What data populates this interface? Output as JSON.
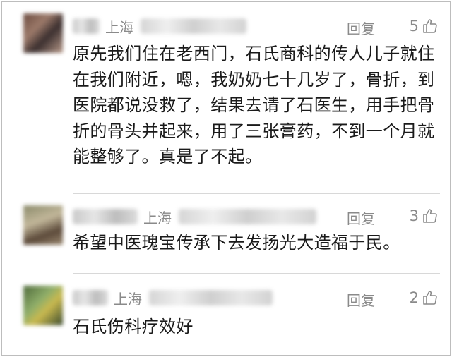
{
  "comments": [
    {
      "location": "上海",
      "reply_label": "回复",
      "likes": "5",
      "text": "原先我们住在老西门，石氏商科的传人儿子就住在我们附近，嗯，我奶奶七十几岁了，骨折，到医院都说没救了，结果去请了石医生，用手把骨折的骨头并起来，用了三张膏药，不到一个月就能整够了。真是了不起。"
    },
    {
      "location": "上海",
      "reply_label": "回复",
      "likes": "3",
      "text": "希望中医瑰宝传承下去发扬光大造福于民。"
    },
    {
      "location": "上海",
      "reply_label": "回复",
      "likes": "2",
      "text": "石氏伤科疗效好"
    }
  ],
  "icons": {
    "like": "thumbs-up-icon"
  },
  "colors": {
    "meta": "#8a8a8a",
    "text": "#1a1a1a",
    "divider": "#d8d8d8"
  }
}
